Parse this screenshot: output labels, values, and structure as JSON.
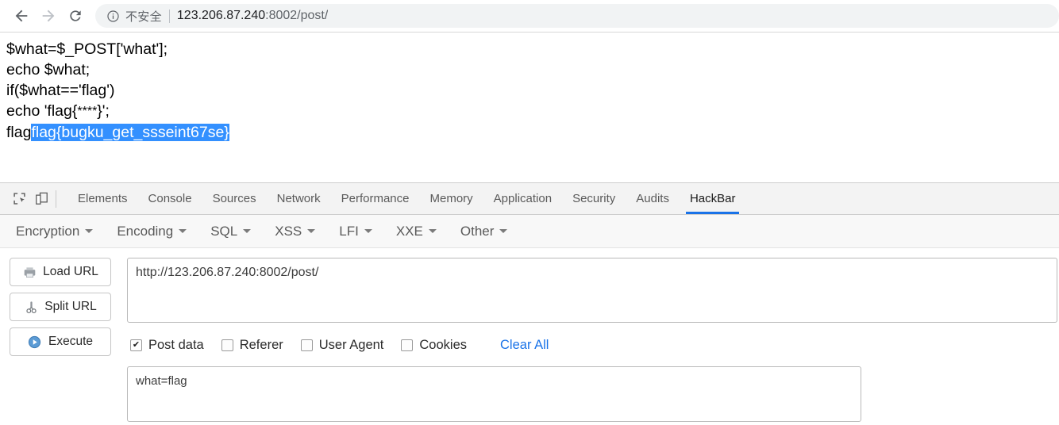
{
  "browser": {
    "back_label": "back-arrow",
    "forward_label": "forward-arrow",
    "reload_label": "reload",
    "security_text": "不安全",
    "url_host": "123.206.87.240",
    "url_rest": ":8002/post/",
    "url_full": "123.206.87.240:8002/post/"
  },
  "page": {
    "code_lines": [
      "$what=$_POST['what'];",
      "echo $what;",
      "if($what=='flag')"
    ],
    "echo_line_prefix": "echo 'flag{",
    "echo_line_stars": "****",
    "echo_line_suffix": "}';",
    "last_line_prefix": "flag",
    "last_line_selected": "flag{bugku_get_ssseint67se}",
    "selection_color": "#3390ff"
  },
  "devtools": {
    "icons": [
      {
        "name": "inspect-element-icon"
      },
      {
        "name": "device-toolbar-icon"
      }
    ],
    "tabs": [
      {
        "label": "Elements",
        "active": false
      },
      {
        "label": "Console",
        "active": false
      },
      {
        "label": "Sources",
        "active": false
      },
      {
        "label": "Network",
        "active": false
      },
      {
        "label": "Performance",
        "active": false
      },
      {
        "label": "Memory",
        "active": false
      },
      {
        "label": "Application",
        "active": false
      },
      {
        "label": "Security",
        "active": false
      },
      {
        "label": "Audits",
        "active": false
      },
      {
        "label": "HackBar",
        "active": true
      }
    ],
    "active_tab_color": "#1a73e8"
  },
  "hackbar": {
    "menus": [
      {
        "label": "Encryption"
      },
      {
        "label": "Encoding"
      },
      {
        "label": "SQL"
      },
      {
        "label": "XSS"
      },
      {
        "label": "LFI"
      },
      {
        "label": "XXE"
      },
      {
        "label": "Other"
      }
    ],
    "buttons": [
      {
        "label": "Load URL",
        "icon": "load-url-icon"
      },
      {
        "label": "Split URL",
        "icon": "split-url-scissors-icon"
      },
      {
        "label": "Execute",
        "icon": "execute-play-icon"
      }
    ],
    "url_value": "http://123.206.87.240:8002/post/",
    "url_placeholder": "",
    "checkboxes": [
      {
        "label": "Post data",
        "checked": true
      },
      {
        "label": "Referer",
        "checked": false
      },
      {
        "label": "User Agent",
        "checked": false
      },
      {
        "label": "Cookies",
        "checked": false
      }
    ],
    "clear_all_label": "Clear All",
    "clear_all_color": "#1a73e8",
    "post_data_value": "what=flag",
    "post_data_placeholder": ""
  }
}
